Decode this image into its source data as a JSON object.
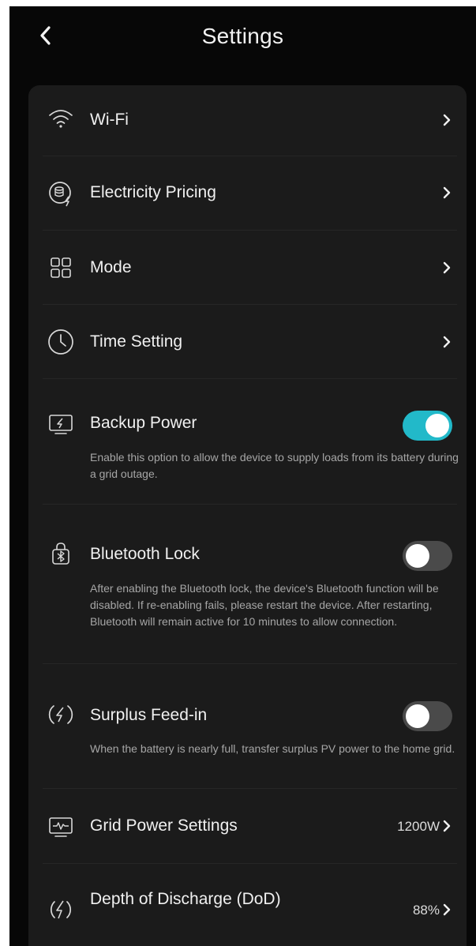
{
  "header": {
    "title": "Settings"
  },
  "items": [
    {
      "label": "Wi-Fi",
      "icon": "wifi-icon"
    },
    {
      "label": "Electricity Pricing",
      "icon": "electricity-pricing-icon"
    },
    {
      "label": "Mode",
      "icon": "mode-grid-icon"
    },
    {
      "label": "Time Setting",
      "icon": "clock-icon"
    },
    {
      "label": "Backup Power",
      "icon": "backup-power-icon",
      "toggle": "on",
      "description": "Enable this option to allow the device to supply loads from its battery during a grid outage."
    },
    {
      "label": "Bluetooth Lock",
      "icon": "bluetooth-lock-icon",
      "toggle": "off",
      "description": "After enabling the Bluetooth lock, the device's Bluetooth function will be disabled. If re-enabling fails, please restart the device. After restarting, Bluetooth will remain active for 10 minutes to allow connection."
    },
    {
      "label": "Surplus Feed-in",
      "icon": "surplus-feed-in-icon",
      "toggle": "off",
      "description": "When the battery is nearly full, transfer surplus PV power to the home grid."
    },
    {
      "label": "Grid Power Settings",
      "icon": "grid-power-icon",
      "value": "1200W"
    },
    {
      "label": "Depth of Discharge (DoD)",
      "icon": "depth-of-discharge-icon",
      "value": "88%"
    }
  ],
  "colors": {
    "background": "#070707",
    "card": "#1b1b1b",
    "toggle_on": "#22b9c9",
    "toggle_off": "#4a4a4a",
    "text": "#f0f0f0",
    "description": "#a6a6a6"
  }
}
